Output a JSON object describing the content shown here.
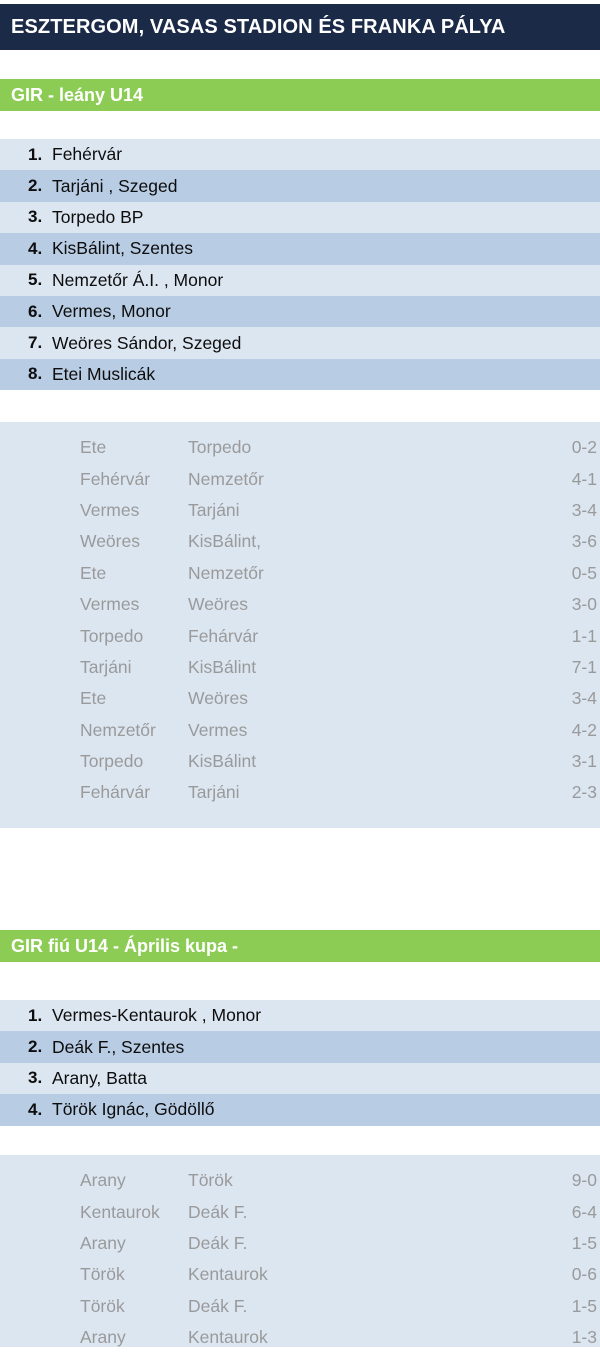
{
  "venue": {
    "title": "ESZTERGOM, VASAS STADION ÉS FRANKA PÁLYA",
    "bar_color": "#1b2a47"
  },
  "palette": {
    "section_header_green": "#8ccc55",
    "row_light": "#dce6f1",
    "row_dark": "#b8cce4",
    "results_text": "#9a9a9a",
    "list_text": "#0d0d0d"
  },
  "sections": [
    {
      "header": "GIR  - leány  U14",
      "teams": [
        {
          "rank": "1.",
          "name": "Fehérvár"
        },
        {
          "rank": "2.",
          "name": "Tarjáni , Szeged"
        },
        {
          "rank": "3.",
          "name": "Torpedo BP"
        },
        {
          "rank": "4.",
          "name": "KisBálint, Szentes"
        },
        {
          "rank": "5.",
          "name": "Nemzetőr Á.I. , Monor"
        },
        {
          "rank": "6.",
          "name": "Vermes, Monor"
        },
        {
          "rank": "7.",
          "name": "Weöres Sándor, Szeged"
        },
        {
          "rank": "8.",
          "name": "Etei Muslicák"
        }
      ],
      "results": [
        {
          "home": "Ete",
          "away": "Torpedo",
          "score": "0-2"
        },
        {
          "home": "Fehérvár",
          "away": "Nemzetőr",
          "score": "4-1"
        },
        {
          "home": "Vermes",
          "away": "Tarjáni",
          "score": "3-4"
        },
        {
          "home": "Weöres",
          "away": "KisBálint,",
          "score": "3-6"
        },
        {
          "home": "Ete",
          "away": "Nemzetőr",
          "score": "0-5"
        },
        {
          "home": "Vermes",
          "away": "Weöres",
          "score": "3-0"
        },
        {
          "home": "Torpedo",
          "away": "Fehárvár",
          "score": "1-1"
        },
        {
          "home": "Tarjáni",
          "away": "KisBálint",
          "score": "7-1"
        },
        {
          "home": "Ete",
          "away": "Weöres",
          "score": "3-4"
        },
        {
          "home": "Nemzetőr",
          "away": "Vermes",
          "score": "4-2"
        },
        {
          "home": "Torpedo",
          "away": "KisBálint",
          "score": "3-1"
        },
        {
          "home": "Fehárvár",
          "away": "Tarjáni",
          "score": "2-3"
        }
      ]
    },
    {
      "header": "GIR fiú  U14 - Április  kupa  -",
      "teams": [
        {
          "rank": "1.",
          "name": "Vermes-Kentaurok , Monor"
        },
        {
          "rank": "2.",
          "name": "Deák F., Szentes"
        },
        {
          "rank": "3.",
          "name": "Arany, Batta"
        },
        {
          "rank": "4.",
          "name": "Török Ignác, Gödöllő"
        }
      ],
      "results": [
        {
          "home": "Arany",
          "away": "Török",
          "score": "9-0"
        },
        {
          "home": "Kentaurok",
          "away": "Deák F.",
          "score": "6-4"
        },
        {
          "home": "Arany",
          "away": "Deák F.",
          "score": "1-5"
        },
        {
          "home": "Török",
          "away": "Kentaurok",
          "score": "0-6"
        },
        {
          "home": "Török",
          "away": "Deák F.",
          "score": "1-5"
        },
        {
          "home": "Arany",
          "away": "Kentaurok",
          "score": "1-3"
        }
      ]
    }
  ]
}
